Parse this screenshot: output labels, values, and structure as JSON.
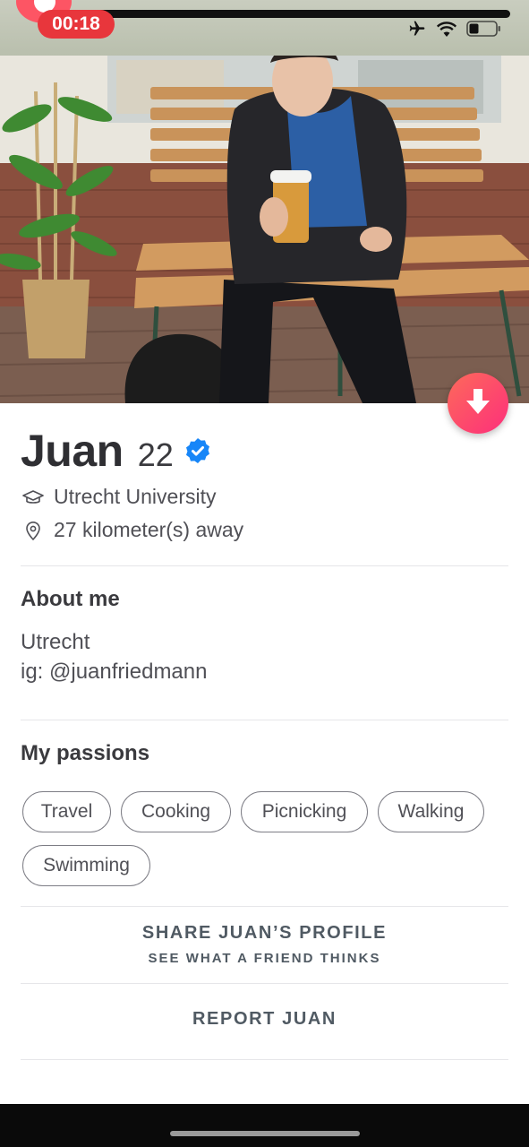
{
  "status_bar": {
    "timer": "00:18",
    "icons": [
      "airplane-icon",
      "wifi-icon",
      "battery-icon"
    ]
  },
  "colors": {
    "accent_gradient_start": "#fd6a5a",
    "accent_gradient_end": "#fd2f7b",
    "verified_blue": "#1786f8",
    "timer_red": "#e8363c"
  },
  "profile": {
    "name": "Juan",
    "age": "22",
    "verified_icon": "verified-badge-icon",
    "school": "Utrecht University",
    "distance": "27 kilometer(s) away"
  },
  "about": {
    "title": "About me",
    "lines": [
      "Utrecht",
      "ig: @juanfriedmann"
    ]
  },
  "passions": {
    "title": "My passions",
    "items": [
      "Travel",
      "Cooking",
      "Picnicking",
      "Walking",
      "Swimming"
    ]
  },
  "share": {
    "title": "SHARE JUAN’S PROFILE",
    "subtitle": "SEE WHAT A FRIEND THINKS"
  },
  "report": {
    "label": "REPORT JUAN"
  }
}
